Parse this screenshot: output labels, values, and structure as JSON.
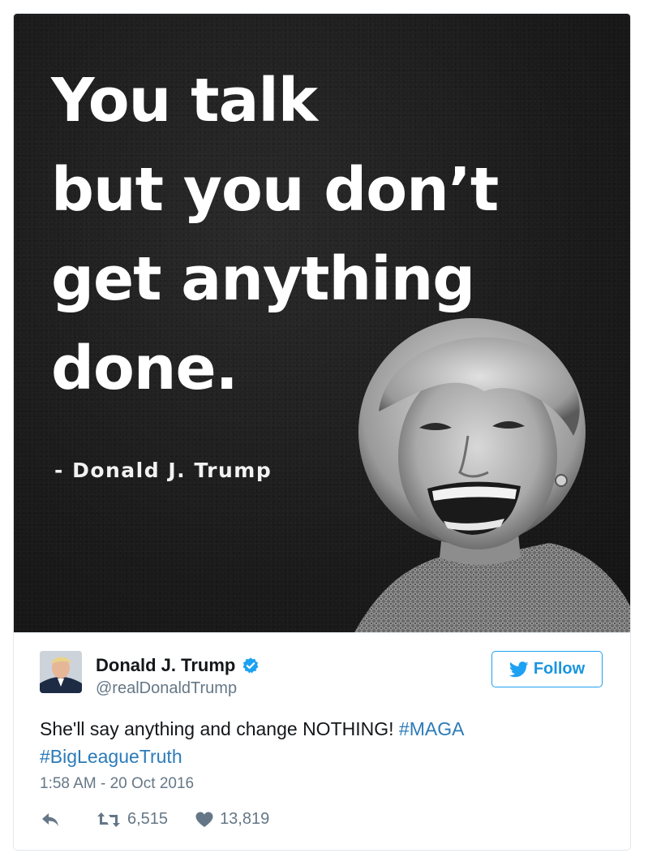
{
  "image": {
    "quote_lines": [
      "You talk",
      "but you don’t",
      "get anything",
      "done."
    ],
    "attribution": "- Donald J. Trump"
  },
  "tweet": {
    "display_name": "Donald J. Trump",
    "handle": "@realDonaldTrump",
    "follow_label": "Follow",
    "text": "She'll say anything and change NOTHING! ",
    "hashtags": [
      "#MAGA",
      "#BigLeagueTruth"
    ],
    "timestamp": "1:58 AM - 20 Oct 2016",
    "retweet_count": "6,515",
    "like_count": "13,819"
  },
  "icons": {
    "verified": "verified-badge-icon",
    "follow": "twitter-bird-icon",
    "reply": "reply-icon",
    "retweet": "retweet-icon",
    "like": "heart-icon"
  },
  "colors": {
    "link": "#2b7bb9",
    "follow": "#1da1f2",
    "muted": "#657786",
    "text": "#14171a",
    "image_bg": "#1b1b1b"
  }
}
